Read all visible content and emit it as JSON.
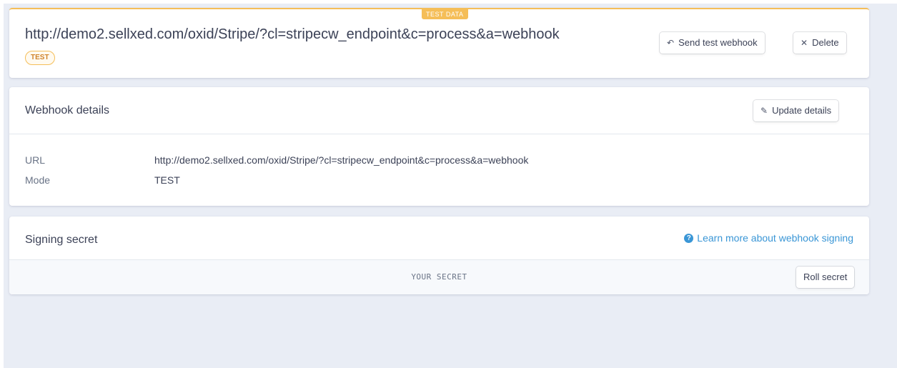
{
  "ribbon": {
    "label": "TEST DATA"
  },
  "header": {
    "title": "http://demo2.sellxed.com/oxid/Stripe/?cl=stripecw_endpoint&c=process&a=webhook",
    "mode_badge": "TEST",
    "send_test_label": "Send test webhook",
    "delete_label": "Delete"
  },
  "details": {
    "heading": "Webhook details",
    "update_label": "Update details",
    "rows": [
      {
        "key": "URL",
        "value": "http://demo2.sellxed.com/oxid/Stripe/?cl=stripecw_endpoint&c=process&a=webhook"
      },
      {
        "key": "Mode",
        "value": "TEST"
      }
    ]
  },
  "signing": {
    "heading": "Signing secret",
    "learn_more": "Learn more about webhook signing",
    "help_glyph": "?",
    "secret_placeholder": "YOUR SECRET",
    "roll_label": "Roll secret"
  },
  "icons": {
    "send": "↶",
    "delete": "✕",
    "edit": "✎"
  },
  "colors": {
    "accent_test": "#f5be58",
    "link": "#3a96d6",
    "background": "#e9edf5"
  }
}
